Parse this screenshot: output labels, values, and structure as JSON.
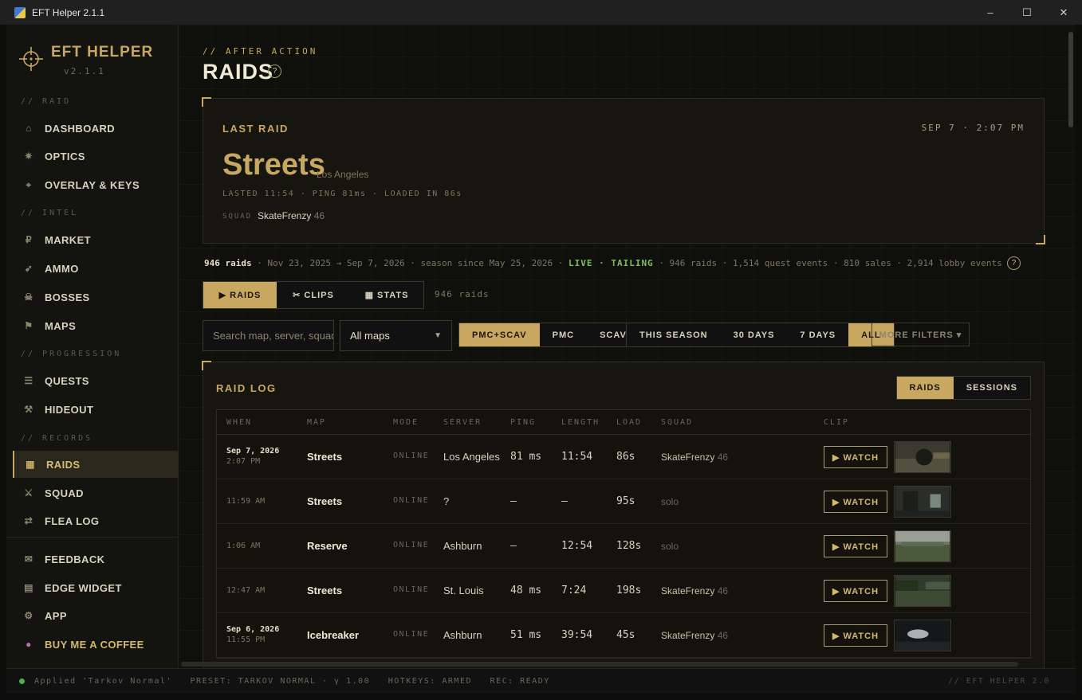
{
  "window": {
    "title": "EFT Helper 2.1.1",
    "min": "–",
    "max": "☐",
    "close": "✕"
  },
  "brand": {
    "name": "EFT HELPER",
    "version": "v2.1.1"
  },
  "sidebar": {
    "sections": [
      "// RAID",
      "// INTEL",
      "// PROGRESSION",
      "// RECORDS"
    ],
    "items": [
      {
        "label": "DASHBOARD",
        "icon": "⌂"
      },
      {
        "label": "OPTICS",
        "icon": "✷"
      },
      {
        "label": "OVERLAY & KEYS",
        "icon": "⌖"
      },
      {
        "label": "MARKET",
        "icon": "₽"
      },
      {
        "label": "AMMO",
        "icon": "➶"
      },
      {
        "label": "BOSSES",
        "icon": "☠"
      },
      {
        "label": "MAPS",
        "icon": "⚑"
      },
      {
        "label": "QUESTS",
        "icon": "☰"
      },
      {
        "label": "HIDEOUT",
        "icon": "⚒"
      },
      {
        "label": "RAIDS",
        "icon": "▦"
      },
      {
        "label": "SQUAD",
        "icon": "⚔"
      },
      {
        "label": "FLEA LOG",
        "icon": "⇄"
      }
    ],
    "bottom": [
      {
        "label": "FEEDBACK",
        "icon": "✉"
      },
      {
        "label": "EDGE WIDGET",
        "icon": "▤"
      },
      {
        "label": "APP",
        "icon": "⚙"
      },
      {
        "label": "BUY ME A COFFEE",
        "icon": "●"
      }
    ]
  },
  "page": {
    "crumb": "// AFTER ACTION",
    "title": "RAIDS",
    "help": "?"
  },
  "last_raid": {
    "label": "LAST RAID",
    "date": "SEP 7 · 2:07 PM",
    "map": "Streets",
    "city": "Los Angeles",
    "meta": "LASTED 11:54 · PING 81ms · LOADED IN 86s",
    "squad_label": "SQUAD",
    "squad_name": "SkateFrenzy",
    "squad_num": "46"
  },
  "status": {
    "raids": "946 raids",
    "range": " · Nov 23, 2025 → Sep 7, 2026 · season since May 25, 2026 · ",
    "live": "LIVE · TAILING",
    "tail": " · 946 raids · 1,514 quest events · 810 sales · 2,914 lobby events",
    "help": "?"
  },
  "tabs": {
    "raids": "▶ RAIDS",
    "clips": "✂ CLIPS",
    "stats": "▦ STATS",
    "count": "946 raids"
  },
  "filters": {
    "search_placeholder": "Search map, server, squadmate",
    "map_select": "All maps",
    "side": [
      "PMC+SCAV",
      "PMC",
      "SCAV"
    ],
    "period": [
      "THIS SEASON",
      "30 DAYS",
      "7 DAYS",
      "ALL"
    ],
    "more": "MORE FILTERS ▾"
  },
  "log": {
    "title": "RAID LOG",
    "toggle": [
      "RAIDS",
      "SESSIONS"
    ],
    "headers": [
      "WHEN",
      "MAP",
      "MODE",
      "SERVER",
      "PING",
      "LENGTH",
      "LOAD",
      "SQUAD",
      "CLIP"
    ],
    "watch": "▶ WATCH",
    "rows": [
      {
        "date": "Sep 7, 2026",
        "time": "2:07 PM",
        "map": "Streets",
        "mode": "ONLINE",
        "server": "Los Angeles",
        "ping": "81 ms",
        "length": "11:54",
        "load": "86s",
        "squad": "SkateFrenzy",
        "squad_n": "46"
      },
      {
        "date": "",
        "time": "11:59 AM",
        "map": "Streets",
        "mode": "ONLINE",
        "server": "?",
        "ping": "—",
        "length": "—",
        "load": "95s",
        "squad": "solo",
        "squad_n": ""
      },
      {
        "date": "",
        "time": "1:06 AM",
        "map": "Reserve",
        "mode": "ONLINE",
        "server": "Ashburn",
        "ping": "—",
        "length": "12:54",
        "load": "128s",
        "squad": "solo",
        "squad_n": ""
      },
      {
        "date": "",
        "time": "12:47 AM",
        "map": "Streets",
        "mode": "ONLINE",
        "server": "St. Louis",
        "ping": "48 ms",
        "length": "7:24",
        "load": "198s",
        "squad": "SkateFrenzy",
        "squad_n": "46"
      },
      {
        "date": "Sep 6, 2026",
        "time": "11:55 PM",
        "map": "Icebreaker",
        "mode": "ONLINE",
        "server": "Ashburn",
        "ping": "51 ms",
        "length": "39:54",
        "load": "45s",
        "squad": "SkateFrenzy",
        "squad_n": "46"
      }
    ]
  },
  "footer": {
    "text": "Applied 'Tarkov Normal'   PRESET: TARKOV NORMAL · γ 1.00   HOTKEYS: ARMED   REC: READY",
    "right": "// EFT HELPER 2.0"
  },
  "colors": {
    "accent": "#c8a860",
    "live": "#7fbf5a",
    "bg": "#0f0f0c"
  }
}
